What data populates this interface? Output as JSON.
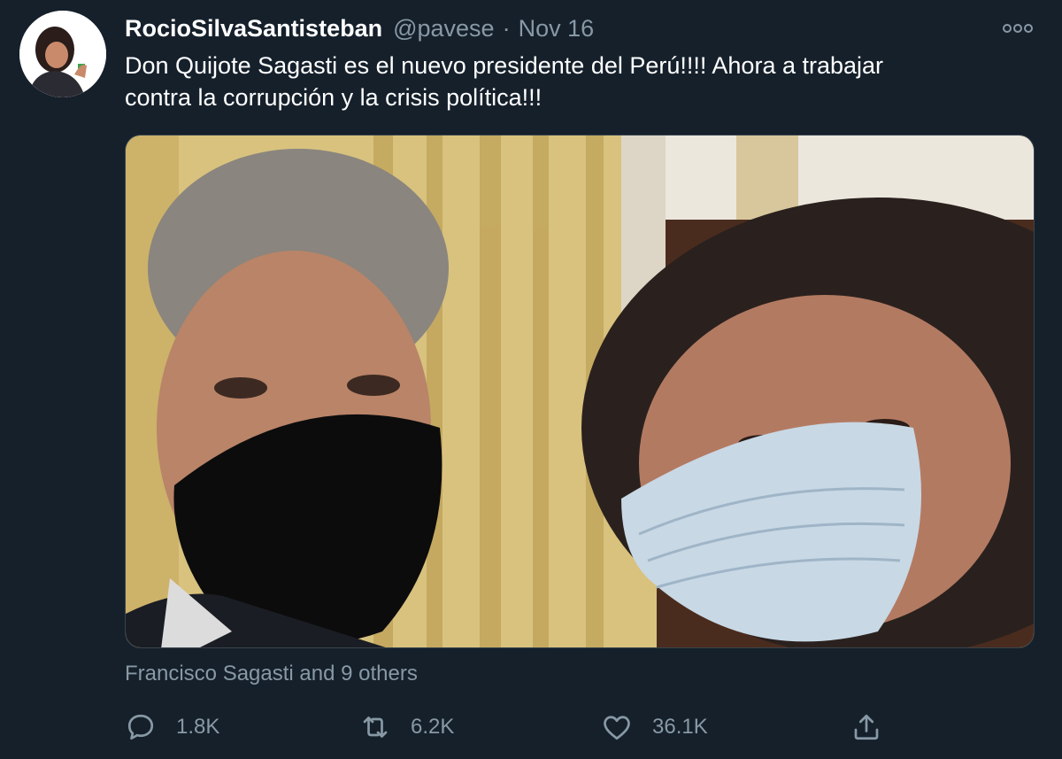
{
  "tweet": {
    "display_name": "RocioSilvaSantisteban",
    "handle": "@pavese",
    "separator": "·",
    "date": "Nov 16",
    "text_line1": "Don Quijote Sagasti es el nuevo presidente del Perú!!!! Ahora a trabajar",
    "text_line2": "contra la corrupción y la crisis política!!!",
    "tagged_users": "Francisco Sagasti and 9 others"
  },
  "actions": {
    "reply_count": "1.8K",
    "retweet_count": "6.2K",
    "like_count": "36.1K"
  },
  "icons": {
    "reply": "reply-icon",
    "retweet": "retweet-icon",
    "like": "heart-icon",
    "share": "share-icon",
    "more": "more-options-icon"
  },
  "colors": {
    "background": "#15202b",
    "secondary_text": "#8899a6",
    "primary_text": "#ffffff",
    "border": "#38444d"
  }
}
